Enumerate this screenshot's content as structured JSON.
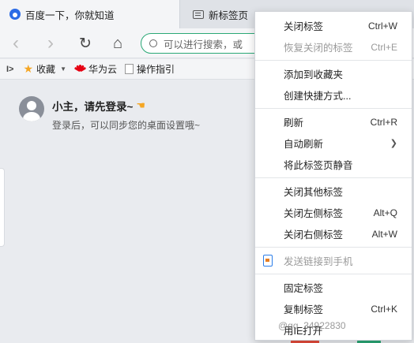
{
  "tabs": [
    {
      "label": "百度一下，你就知道",
      "icon": "baidu-paw-icon",
      "active": true
    },
    {
      "label": "新标签页",
      "icon": "newtab-icon",
      "active": false
    }
  ],
  "toolbar": {
    "back_icon": "‹",
    "forward_icon": "›",
    "reload_icon": "↻",
    "home_icon": "⌂",
    "address_placeholder": "可以进行搜索，或"
  },
  "bookmarks": [
    {
      "label": "收藏",
      "icon": "star-icon"
    },
    {
      "label": "华为云",
      "icon": "huawei-icon"
    },
    {
      "label": "操作指引",
      "icon": "document-icon"
    }
  ],
  "login": {
    "title": "小主，请先登录~",
    "subtitle": "登录后，可以同步您的桌面设置哦~"
  },
  "menu": {
    "groups": [
      [
        {
          "label": "关闭标签",
          "shortcut": "Ctrl+W",
          "disabled": false
        },
        {
          "label": "恢复关闭的标签",
          "shortcut": "Ctrl+E",
          "disabled": true
        }
      ],
      [
        {
          "label": "添加到收藏夹",
          "shortcut": "",
          "disabled": false
        },
        {
          "label": "创建快捷方式...",
          "shortcut": "",
          "disabled": false
        }
      ],
      [
        {
          "label": "刷新",
          "shortcut": "Ctrl+R",
          "disabled": false
        },
        {
          "label": "自动刷新",
          "shortcut": "",
          "disabled": false,
          "submenu": true
        },
        {
          "label": "将此标签页静音",
          "shortcut": "",
          "disabled": false
        }
      ],
      [
        {
          "label": "关闭其他标签",
          "shortcut": "",
          "disabled": false
        },
        {
          "label": "关闭左侧标签",
          "shortcut": "Alt+Q",
          "disabled": false
        },
        {
          "label": "关闭右侧标签",
          "shortcut": "Alt+W",
          "disabled": false
        }
      ],
      [
        {
          "label": "发送链接到手机",
          "shortcut": "",
          "disabled": true,
          "icon": "phone-send-icon"
        }
      ],
      [
        {
          "label": "固定标签",
          "shortcut": "",
          "disabled": false
        },
        {
          "label": "复制标签",
          "shortcut": "Ctrl+K",
          "disabled": false
        },
        {
          "label": "用IE打开",
          "shortcut": "",
          "disabled": false
        }
      ]
    ]
  },
  "watermark": "@qq_34922830",
  "colors": {
    "accent_green": "#2aa876",
    "accent_blue": "#2b6be6",
    "disabled_text": "#9a9a9a"
  }
}
